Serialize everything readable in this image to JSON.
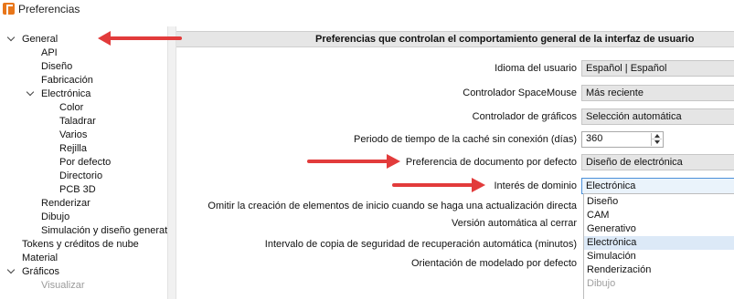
{
  "window": {
    "title": "Preferencias"
  },
  "tree": {
    "items": [
      {
        "label": "General",
        "name": "tree-item-general"
      },
      {
        "label": "API",
        "name": "tree-item-api"
      },
      {
        "label": "Diseño",
        "name": "tree-item-diseno"
      },
      {
        "label": "Fabricación",
        "name": "tree-item-fabricacion"
      },
      {
        "label": "Electrónica",
        "name": "tree-item-electronica"
      },
      {
        "label": "Color",
        "name": "tree-item-color"
      },
      {
        "label": "Taladrar",
        "name": "tree-item-taladrar"
      },
      {
        "label": "Varios",
        "name": "tree-item-varios"
      },
      {
        "label": "Rejilla",
        "name": "tree-item-rejilla"
      },
      {
        "label": "Por defecto",
        "name": "tree-item-por-defecto"
      },
      {
        "label": "Directorio",
        "name": "tree-item-directorio"
      },
      {
        "label": "PCB 3D",
        "name": "tree-item-pcb-3d"
      },
      {
        "label": "Renderizar",
        "name": "tree-item-renderizar"
      },
      {
        "label": "Dibujo",
        "name": "tree-item-dibujo"
      },
      {
        "label": "Simulación y diseño generativo",
        "name": "tree-item-simulacion"
      },
      {
        "label": "Tokens y créditos de nube",
        "name": "tree-item-tokens"
      },
      {
        "label": "Material",
        "name": "tree-item-material"
      },
      {
        "label": "Gráficos",
        "name": "tree-item-graficos"
      },
      {
        "label": "Visualizar",
        "name": "tree-item-visualizar"
      }
    ]
  },
  "panel": {
    "header": "Preferencias que controlan el comportamiento general de la interfaz de usuario",
    "settings": {
      "user_language": {
        "label": "Idioma del usuario",
        "value": "Español | Español"
      },
      "spacemouse": {
        "label": "Controlador SpaceMouse",
        "value": "Más reciente"
      },
      "graphics_driver": {
        "label": "Controlador de gráficos",
        "value": "Selección automática"
      },
      "offline_cache": {
        "label": "Periodo de tiempo de la caché sin conexión (días)",
        "value": "360"
      },
      "default_document": {
        "label": "Preferencia de documento por defecto",
        "value": "Diseño de electrónica"
      },
      "domain_interest": {
        "label": "Interés de dominio",
        "value": "Electrónica"
      },
      "skip_start_elements": {
        "label": "Omitir la creación de elementos de inicio cuando se haga una actualización directa"
      },
      "auto_version": {
        "label": "Versión automática al cerrar"
      },
      "backup_interval": {
        "label": "Intervalo de copia de seguridad de recuperación automática (minutos)"
      },
      "modeling_orientation": {
        "label": "Orientación de modelado por defecto"
      }
    },
    "dropdown": {
      "options": [
        "Diseño",
        "CAM",
        "Generativo",
        "Electrónica",
        "Simulación",
        "Renderización",
        "Dibujo"
      ],
      "selected": "Electrónica"
    }
  },
  "colors": {
    "annotation_arrow": "#e23b3b",
    "selection": "#dce9f7",
    "accent_border": "#4a90d9",
    "app_icon": "#e8761a"
  }
}
